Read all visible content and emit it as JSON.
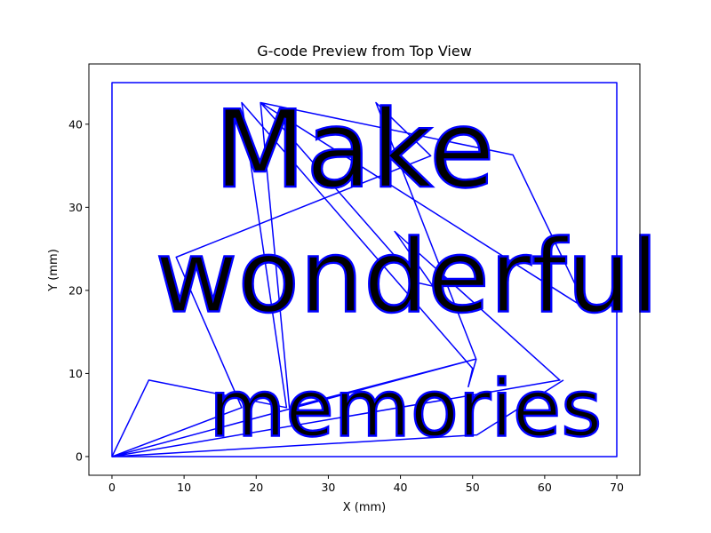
{
  "chart_data": {
    "type": "line",
    "title": "G-code Preview from Top View",
    "xlabel": "X (mm)",
    "ylabel": "Y (mm)",
    "xlim": [
      -3.2,
      73.2
    ],
    "ylim": [
      -2.25,
      47.25
    ],
    "xticks": [
      0,
      10,
      20,
      30,
      40,
      50,
      60,
      70
    ],
    "yticks": [
      0,
      10,
      20,
      30,
      40
    ],
    "grid": false,
    "line_color": "#0000ff",
    "series": [
      {
        "type": "border",
        "x": [
          0,
          70,
          70,
          0,
          0
        ],
        "y": [
          0,
          0,
          45,
          45,
          0
        ]
      },
      {
        "type": "travel-moves",
        "x": [
          0,
          50.3,
          24.6,
          20.6,
          55.6,
          65.9,
          20.6,
          42.5,
          44.5,
          39.2,
          62.1,
          0,
          5.1,
          24.2,
          18.0,
          50.0,
          49.4,
          50.5,
          36.6,
          44.2,
          8.9,
          18.0,
          0,
          50.6,
          62.6
        ],
        "y": [
          0,
          11.7,
          5.9,
          42.6,
          36.3,
          17.7,
          42.6,
          20.9,
          20.5,
          27.1,
          9.2,
          0,
          9.2,
          5.9,
          42.6,
          10.6,
          8.4,
          11.7,
          42.6,
          36.2,
          24.0,
          5.9,
          0,
          2.6,
          9.2
        ]
      }
    ],
    "text_paths": [
      {
        "text": "Make",
        "x_center": 33.6,
        "baseline_y": 32.5,
        "height": 9.5
      },
      {
        "text": "wonderful",
        "x_center": 40.9,
        "baseline_y": 17.5,
        "height": 9.0
      },
      {
        "text": "memories",
        "x_center": 40.7,
        "baseline_y": 2.5,
        "height": 7.0
      }
    ]
  }
}
